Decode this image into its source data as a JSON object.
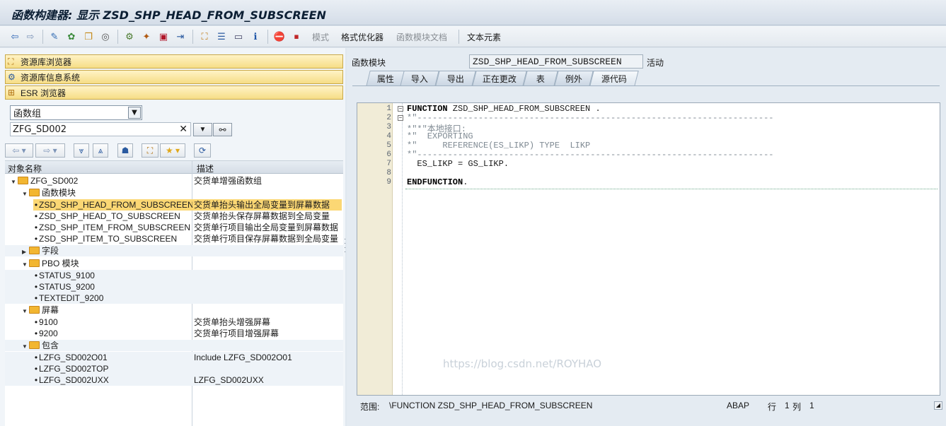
{
  "window": {
    "title": "函数构建器: 显示 ZSD_SHP_HEAD_FROM_SUBSCREEN"
  },
  "toolbar": {
    "pattern_label": "模式",
    "pretty_printer_label": "格式优化器",
    "fm_doc_label": "函数模块文档",
    "text_elements_label": "文本元素"
  },
  "navigator": {
    "repository_browser": "资源库浏览器",
    "repository_info_system": "资源库信息系统",
    "esr_browser": "ESR 浏览器"
  },
  "object_type": {
    "selected": "函数组"
  },
  "object_name": {
    "value": "ZFG_SD002",
    "clear": "✕"
  },
  "tree": {
    "col_name": "对象名称",
    "col_desc": "描述",
    "rows": [
      {
        "name": "ZFG_SD002",
        "desc": "交货单增强函数组"
      },
      {
        "name": "函数模块",
        "desc": ""
      },
      {
        "name": "ZSD_SHP_HEAD_FROM_SUBSCREEN",
        "desc": "交货单抬头输出全局变量到屏幕数据"
      },
      {
        "name": "ZSD_SHP_HEAD_TO_SUBSCREEN",
        "desc": "交货单抬头保存屏幕数据到全局变量"
      },
      {
        "name": "ZSD_SHP_ITEM_FROM_SUBSCREEN",
        "desc": "交货单行项目输出全局变量到屏幕数据"
      },
      {
        "name": "ZSD_SHP_ITEM_TO_SUBSCREEN",
        "desc": "交货单行项目保存屏幕数据到全局变量"
      },
      {
        "name": "字段",
        "desc": ""
      },
      {
        "name": "PBO 模块",
        "desc": ""
      },
      {
        "name": "STATUS_9100",
        "desc": ""
      },
      {
        "name": "STATUS_9200",
        "desc": ""
      },
      {
        "name": "TEXTEDIT_9200",
        "desc": ""
      },
      {
        "name": "屏幕",
        "desc": ""
      },
      {
        "name": "9100",
        "desc": "交货单抬头增强屏幕"
      },
      {
        "name": "9200",
        "desc": "交货单行项目增强屏幕"
      },
      {
        "name": "包含",
        "desc": ""
      },
      {
        "name": "LZFG_SD002O01",
        "desc": "Include LZFG_SD002O01"
      },
      {
        "name": "LZFG_SD002TOP",
        "desc": ""
      },
      {
        "name": "LZFG_SD002UXX",
        "desc": "LZFG_SD002UXX"
      }
    ]
  },
  "header": {
    "label": "函数模块",
    "fm_name": "ZSD_SHP_HEAD_FROM_SUBSCREEN",
    "status": "活动"
  },
  "tabs": [
    "属性",
    "导入",
    "导出",
    "正在更改",
    "表",
    "例外",
    "源代码"
  ],
  "editor": {
    "line_numbers": [
      "1",
      "2",
      "3",
      "4",
      "5",
      "6",
      "7",
      "8",
      "9"
    ],
    "lines": [
      {
        "kw": "FUNCTION",
        "rest": " ZSD_SHP_HEAD_FROM_SUBSCREEN ."
      },
      {
        "cm": "*\"----------------------------------------------------------------------"
      },
      {
        "cm": "*\"*\"本地接口:"
      },
      {
        "cm": "*\"  EXPORTING"
      },
      {
        "cm": "*\"     REFERENCE(ES_LIKP) TYPE  LIKP"
      },
      {
        "cm": "*\"----------------------------------------------------------------------"
      },
      {
        "code": "  ES_LIKP = GS_LIKP."
      },
      {
        "code": ""
      },
      {
        "kw": "ENDFUNCTION",
        "rest": "."
      }
    ]
  },
  "statusbar": {
    "scope_label": "范围:",
    "scope_value": "\\FUNCTION ZSD_SHP_HEAD_FROM_SUBSCREEN",
    "language": "ABAP",
    "row_label": "行",
    "row_value": "1",
    "col_label": "列",
    "col_value": "1"
  },
  "watermark": "https://blog.csdn.net/ROYHAO",
  "colors": {
    "highlight": "#fbd774",
    "nav_button": "#f6dd86",
    "folder": "#f2b631"
  }
}
